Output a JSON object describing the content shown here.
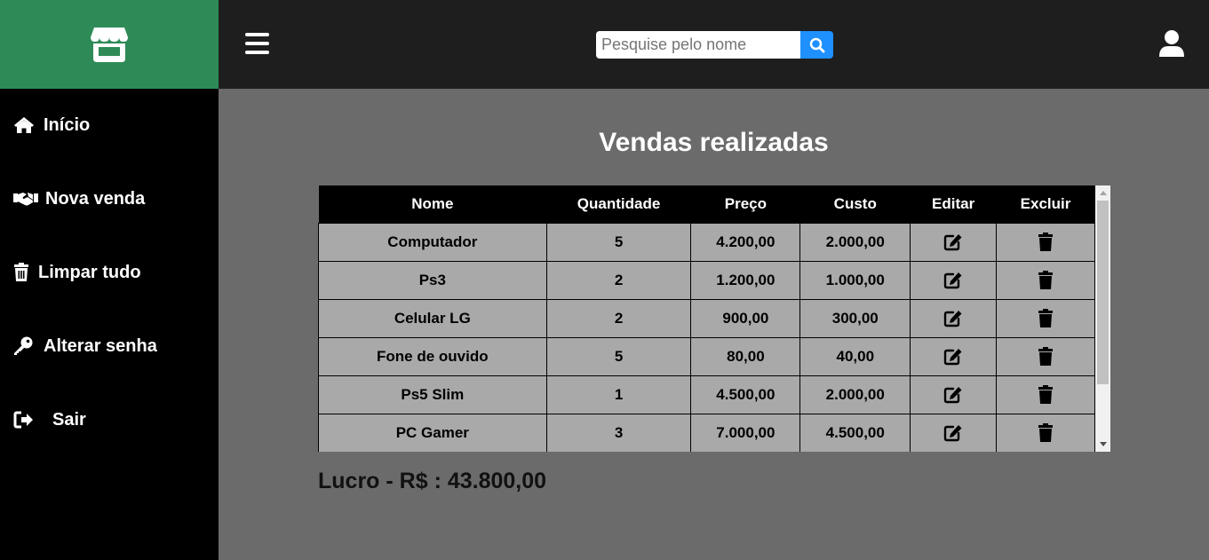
{
  "header": {
    "logo_icon": "store-icon",
    "menu_icon": "hamburger-icon",
    "search": {
      "placeholder": "Pesquise pelo nome",
      "value": ""
    },
    "search_icon": "search-icon",
    "user_icon": "user-icon"
  },
  "sidebar": {
    "items": [
      {
        "label": "Início",
        "icon": "home-icon"
      },
      {
        "label": "Nova venda",
        "icon": "handshake-icon"
      },
      {
        "label": "Limpar tudo",
        "icon": "trash-icon"
      },
      {
        "label": "Alterar senha",
        "icon": "key-icon"
      },
      {
        "label": "Sair",
        "icon": "logout-icon"
      }
    ]
  },
  "main": {
    "title": "Vendas realizadas",
    "table": {
      "columns": [
        "Nome",
        "Quantidade",
        "Preço",
        "Custo",
        "Editar",
        "Excluir"
      ],
      "rows": [
        [
          "Computador",
          "5",
          "4.200,00",
          "2.000,00"
        ],
        [
          "Ps3",
          "2",
          "1.200,00",
          "1.000,00"
        ],
        [
          "Celular LG",
          "2",
          "900,00",
          "300,00"
        ],
        [
          "Fone de ouvido",
          "5",
          "80,00",
          "40,00"
        ],
        [
          "Ps5 Slim",
          "1",
          "4.500,00",
          "2.000,00"
        ],
        [
          "PC Gamer",
          "3",
          "7.000,00",
          "4.500,00"
        ]
      ],
      "edit_icon": "edit-icon",
      "delete_icon": "trash-icon"
    },
    "lucro": "Lucro - R$ : 43.800,00"
  },
  "colors": {
    "logo_bg": "#2e8b57",
    "topbar_bg": "#1e1e1e",
    "sidebar_bg": "#000000",
    "main_bg": "#6b6b6b",
    "row_bg": "#a9a9a9",
    "search_button": "#1e90ff"
  }
}
